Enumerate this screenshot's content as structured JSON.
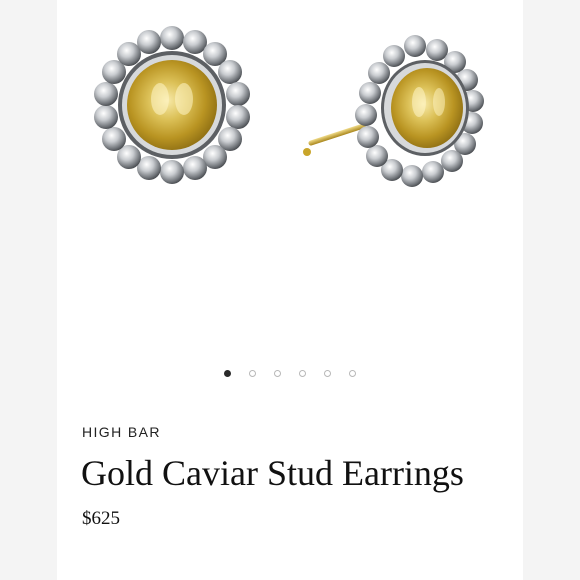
{
  "product": {
    "image_alt": "earrings-photo",
    "brand": "HIGH BAR",
    "title": "Gold Caviar Stud Earrings",
    "price": "$625"
  },
  "carousel": {
    "slide_count": 6,
    "active_index": 0
  },
  "colors": {
    "gold": "#c9a52a",
    "silver": "#9ea2a6",
    "active_dot": "#2a2a2a",
    "inactive_dot_border": "#b8b8b8"
  }
}
